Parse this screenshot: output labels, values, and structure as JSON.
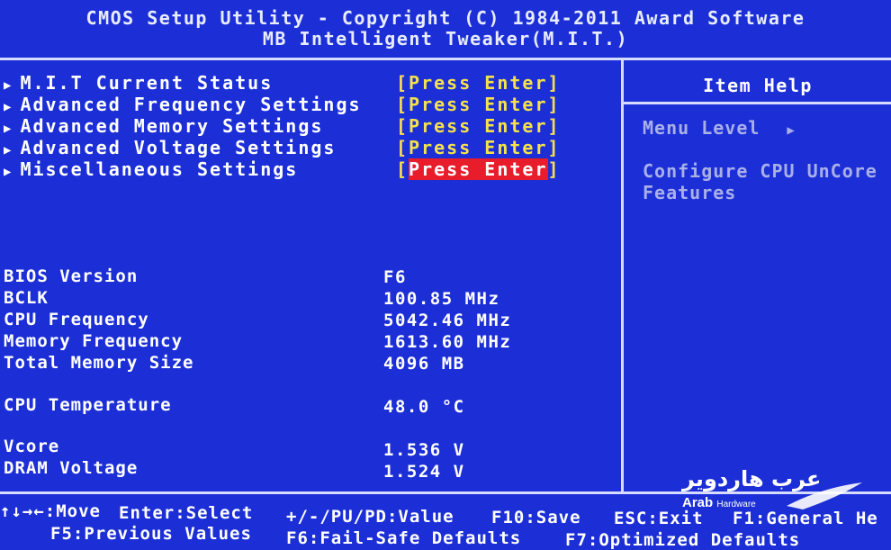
{
  "header": {
    "title": "CMOS Setup Utility - Copyright (C) 1984-2011 Award Software",
    "subtitle": "MB Intelligent Tweaker(M.I.T.)"
  },
  "menu": {
    "items": [
      {
        "label": "M.I.T Current Status",
        "value": "[Press Enter]"
      },
      {
        "label": "Advanced Frequency Settings",
        "value": "[Press Enter]"
      },
      {
        "label": "Advanced Memory Settings",
        "value": "[Press Enter]"
      },
      {
        "label": "Advanced Voltage Settings",
        "value": "[Press Enter]"
      },
      {
        "label": "Miscellaneous Settings",
        "value": "Press Enter",
        "selected": true
      }
    ]
  },
  "info": {
    "rows": [
      {
        "label": "BIOS Version",
        "value": "F6"
      },
      {
        "label": "BCLK",
        "value": "100.85 MHz"
      },
      {
        "label": "CPU Frequency",
        "value": "5042.46 MHz"
      },
      {
        "label": "Memory Frequency",
        "value": "1613.60 MHz"
      },
      {
        "label": "Total Memory Size",
        "value": "4096 MB"
      },
      {
        "label": "CPU Temperature",
        "value": "48.0 °C"
      },
      {
        "label": "Vcore",
        "value": "1.536 V"
      },
      {
        "label": "DRAM Voltage",
        "value": "1.524 V"
      }
    ]
  },
  "help": {
    "title": "Item Help",
    "menu_level": "Menu Level",
    "description_1": "Configure CPU UnCore",
    "description_2": "Features"
  },
  "footer": {
    "move": "↑↓→←:Move",
    "select": "Enter:Select",
    "value": "+/-/PU/PD:Value",
    "save": "F10:Save",
    "exit": "ESC:Exit",
    "general_help": "F1:General He",
    "previous": "F5:Previous Values",
    "failsafe": "F6:Fail-Safe Defaults",
    "optimized": "F7:Optimized Defaults"
  },
  "watermark": {
    "arabic": "عرب هاردوير",
    "english": "Arab",
    "english_small": "Hardware"
  },
  "colors": {
    "background": "#1c2fd6",
    "value_yellow": "#f5e24a",
    "highlight_red": "#e81c2a",
    "help_text": "#a9b0e8"
  }
}
